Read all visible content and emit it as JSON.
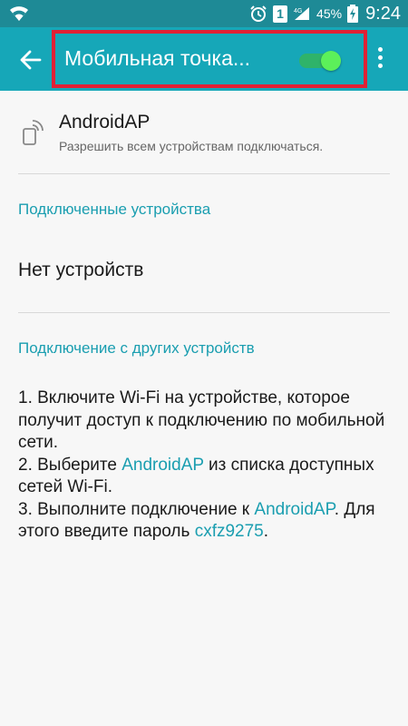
{
  "status_bar": {
    "sim_slot": "1",
    "battery_percent": "45%",
    "time": "9:24",
    "icons": [
      "wifi-icon",
      "alarm-icon",
      "sim-icon",
      "signal-icon",
      "battery-charging-icon"
    ]
  },
  "toolbar": {
    "title": "Мобильная точка...",
    "toggle_on": true,
    "accent_color": "#16a7b8"
  },
  "access_point": {
    "name": "AndroidAP",
    "subtitle": "Разрешить всем устройствам подключаться."
  },
  "connected": {
    "header": "Подключенные устройства",
    "empty_text": "Нет устройств"
  },
  "other_devices": {
    "header": "Подключение с других устройств",
    "step1": "1. Включите Wi-Fi на устройстве, которое получит доступ к подключению по мобильной сети.",
    "step2_prefix": "2. Выберите ",
    "step2_network": "AndroidAP",
    "step2_suffix": " из списка доступных сетей Wi-Fi.",
    "step3_prefix": "3. Выполните подключение к ",
    "step3_network": "AndroidAP",
    "step3_mid": ". Для этого введите пароль ",
    "step3_password": "cxfz9275",
    "step3_end": "."
  }
}
